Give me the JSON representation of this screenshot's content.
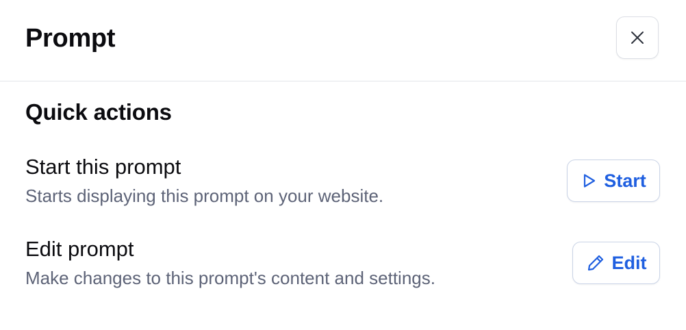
{
  "header": {
    "title": "Prompt",
    "close_icon": "close-icon"
  },
  "quick_actions": {
    "title": "Quick actions",
    "items": [
      {
        "title": "Start this prompt",
        "description": "Starts displaying this prompt on your website.",
        "button_label": "Start",
        "button_icon": "play-icon"
      },
      {
        "title": "Edit prompt",
        "description": "Make changes to this prompt's content and settings.",
        "button_label": "Edit",
        "button_icon": "pencil-icon"
      }
    ]
  },
  "colors": {
    "accent": "#1f5fe0",
    "muted_text": "#5d6377",
    "border": "#dcdfe5"
  }
}
